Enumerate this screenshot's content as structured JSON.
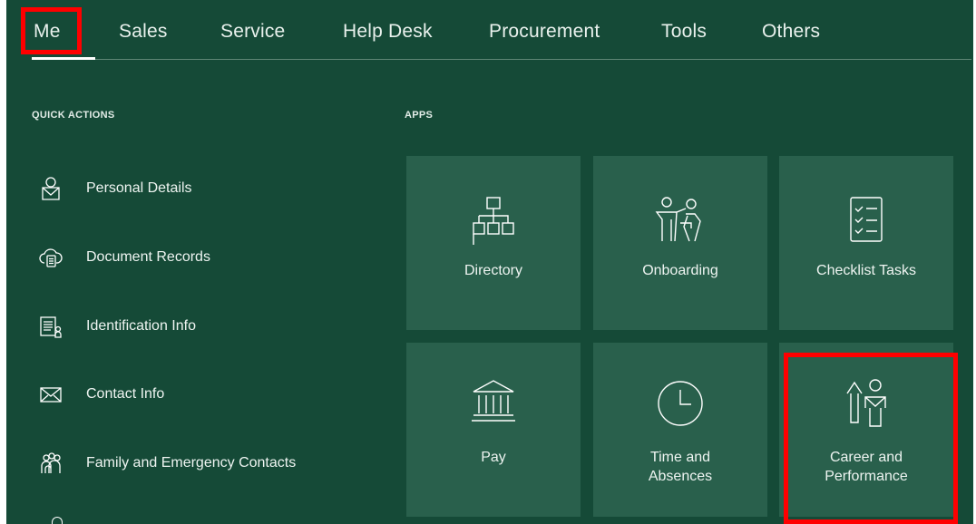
{
  "nav": {
    "tabs": [
      {
        "label": "Me"
      },
      {
        "label": "Sales"
      },
      {
        "label": "Service"
      },
      {
        "label": "Help Desk"
      },
      {
        "label": "Procurement"
      },
      {
        "label": "Tools"
      },
      {
        "label": "Others"
      }
    ]
  },
  "quick_actions": {
    "header": "QUICK ACTIONS",
    "items": [
      {
        "label": "Personal Details",
        "icon": "person-icon"
      },
      {
        "label": "Document Records",
        "icon": "cloud-document-icon"
      },
      {
        "label": "Identification Info",
        "icon": "id-document-icon"
      },
      {
        "label": "Contact Info",
        "icon": "envelope-icon"
      },
      {
        "label": "Family and Emergency Contacts",
        "icon": "family-icon"
      }
    ]
  },
  "apps": {
    "header": "APPS",
    "tiles": [
      {
        "label": "Directory",
        "icon": "org-chart-icon"
      },
      {
        "label": "Onboarding",
        "icon": "onboarding-icon"
      },
      {
        "label": "Checklist Tasks",
        "icon": "checklist-icon"
      },
      {
        "label": "Pay",
        "icon": "bank-icon"
      },
      {
        "label": "Time and Absences",
        "label_line1": "Time and",
        "label_line2": "Absences",
        "icon": "clock-icon"
      },
      {
        "label": "Career and Performance",
        "label_line1": "Career and",
        "label_line2": "Performance",
        "icon": "career-icon"
      }
    ]
  },
  "colors": {
    "background": "#154a37",
    "tile": "#29604c",
    "highlight": "#ff0000"
  }
}
